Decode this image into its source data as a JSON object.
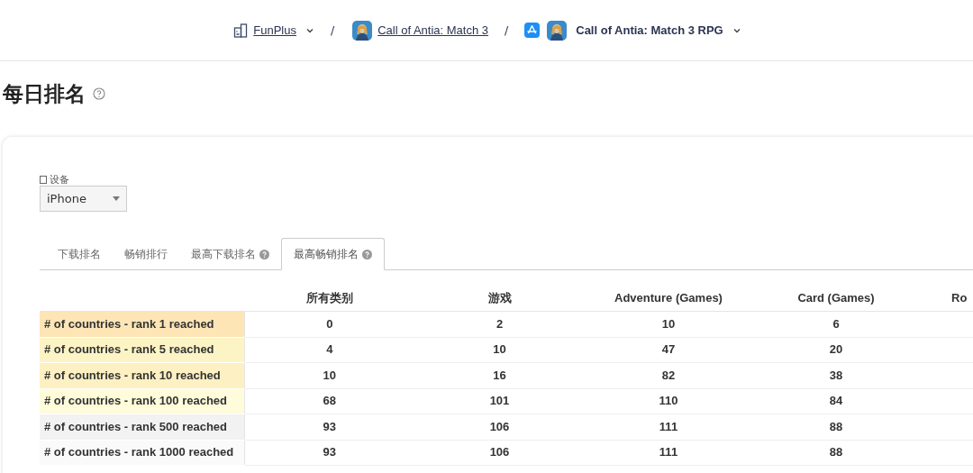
{
  "breadcrumb": {
    "publisher": "FunPlus",
    "app": "Call of Antia: Match 3",
    "product": "Call of Antia: Match 3 RPG",
    "separator": "/"
  },
  "page_title": "每日排名",
  "device": {
    "label": "设备",
    "value": "iPhone"
  },
  "tabs": [
    {
      "label": "下载排名",
      "selected": false,
      "help": false
    },
    {
      "label": "畅销排行",
      "selected": false,
      "help": false
    },
    {
      "label": "最高下载排名",
      "selected": false,
      "help": true
    },
    {
      "label": "最高畅销排名",
      "selected": true,
      "help": true
    }
  ],
  "table": {
    "columns": [
      "所有类别",
      "游戏",
      "Adventure (Games)",
      "Card (Games)",
      "Ro"
    ],
    "rows": [
      {
        "label": "# of countries - rank 1 reached",
        "color": "#fde5b6",
        "values": [
          "0",
          "2",
          "10",
          "6"
        ]
      },
      {
        "label": "# of countries - rank 5 reached",
        "color": "#fdf4c6",
        "values": [
          "4",
          "10",
          "47",
          "20"
        ]
      },
      {
        "label": "# of countries - rank 10 reached",
        "color": "#fdf0c2",
        "values": [
          "10",
          "16",
          "82",
          "38"
        ]
      },
      {
        "label": "# of countries - rank 100 reached",
        "color": "#fefcda",
        "values": [
          "68",
          "101",
          "110",
          "84"
        ]
      },
      {
        "label": "# of countries - rank 500 reached",
        "color": "#f2f2f2",
        "values": [
          "93",
          "106",
          "111",
          "88"
        ]
      },
      {
        "label": "# of countries - rank 1000 reached",
        "color": "#fafafa",
        "values": [
          "93",
          "106",
          "111",
          "88"
        ]
      }
    ]
  }
}
